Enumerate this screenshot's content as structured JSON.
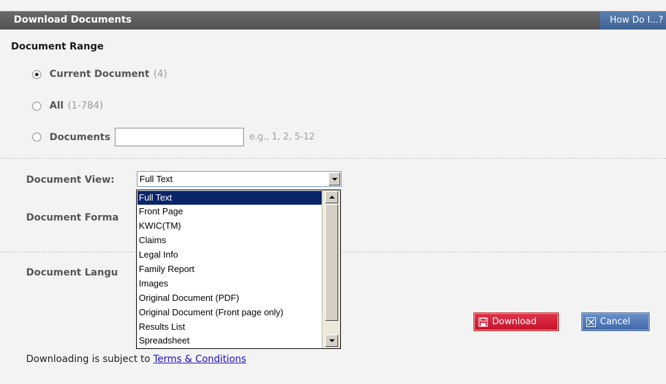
{
  "dialog": {
    "title": "Download Documents",
    "help_link": "How Do I...?"
  },
  "range": {
    "heading": "Document Range",
    "options": [
      {
        "label": "Current Document",
        "hint": "(4)",
        "checked": true
      },
      {
        "label": "All",
        "hint": "(1-784)",
        "checked": false
      },
      {
        "label": "Documents",
        "hint": "",
        "checked": false
      }
    ],
    "documents_input_value": "",
    "example": "e.g., 1, 2, 5-12"
  },
  "fields": {
    "view_label": "Document View:",
    "format_label": "Document Forma",
    "language_label": "Document Langu"
  },
  "view_select": {
    "selected": "Full Text",
    "options": [
      "Full Text",
      "Front Page",
      "KWIC(TM)",
      "Claims",
      "Legal Info",
      "Family Report",
      "Images",
      "Original Document (PDF)",
      "Original Document (Front page only)",
      "Results List",
      "Spreadsheet"
    ],
    "highlighted_index": 0
  },
  "actions": {
    "download_label": "Download",
    "cancel_label": "Cancel"
  },
  "footer": {
    "text": "Downloading is subject to",
    "link": "Terms & Conditions"
  },
  "colors": {
    "titlebar": "#555555",
    "help_bg": "#3e6293",
    "download_bg": "#c4122c",
    "cancel_bg": "#3e68a8",
    "highlight": "#0a246a"
  }
}
